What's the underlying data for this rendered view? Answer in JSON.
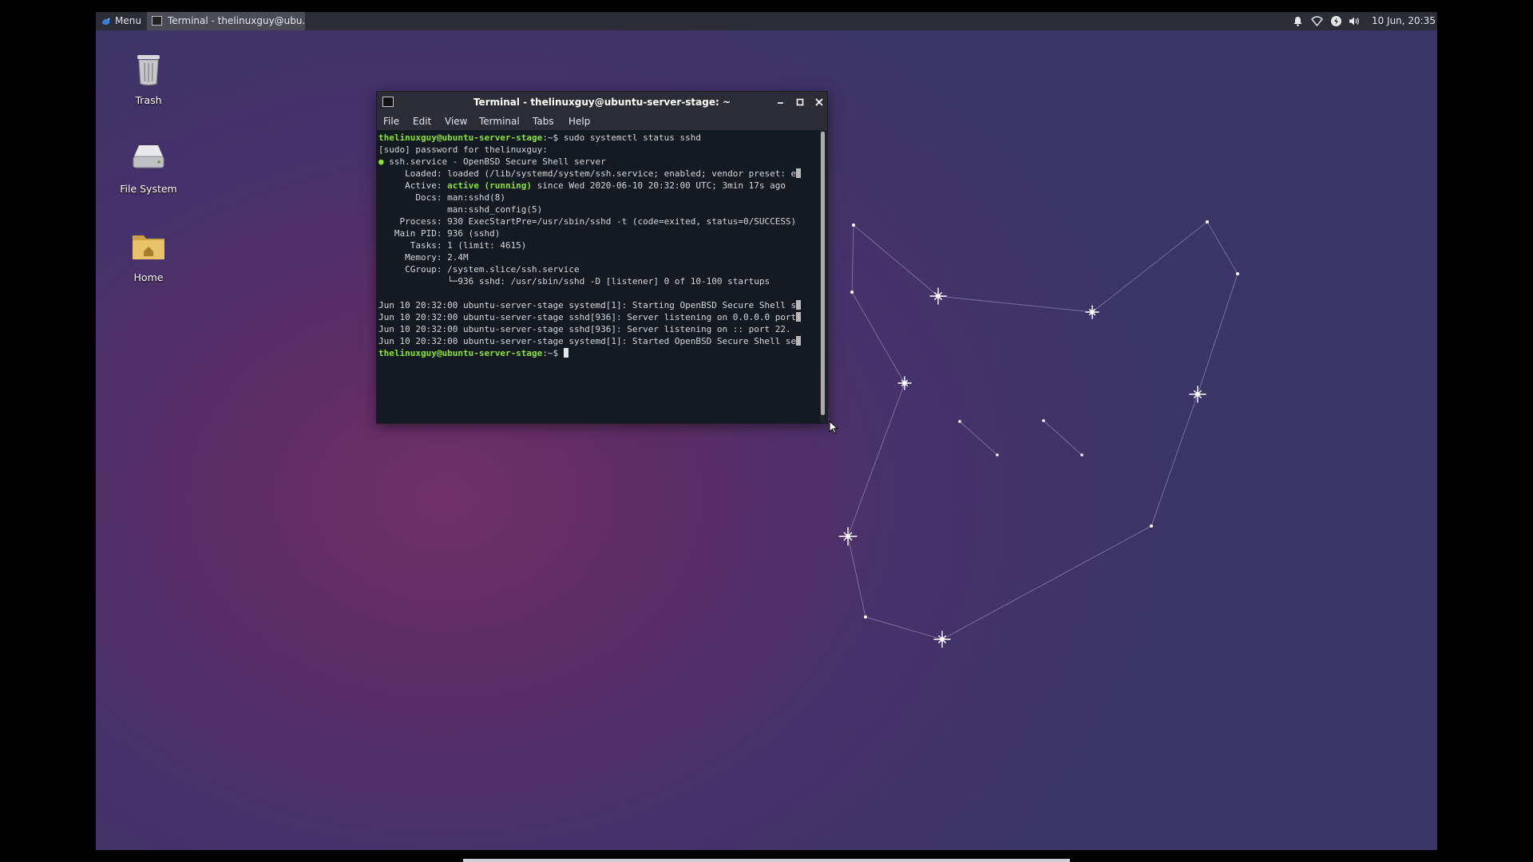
{
  "panel": {
    "menu_label": "Menu",
    "task_label": "Terminal - thelinuxguy@ubu...",
    "clock": "10 Jun, 20:35",
    "tray_icons": [
      "bell-icon",
      "wifi-icon",
      "update-icon",
      "volume-icon"
    ]
  },
  "desktop_icons": {
    "trash": "Trash",
    "filesystem": "File System",
    "home": "Home"
  },
  "terminal": {
    "title": "Terminal - thelinuxguy@ubuntu-server-stage: ~",
    "menu": [
      "File",
      "Edit",
      "View",
      "Terminal",
      "Tabs",
      "Help"
    ],
    "prompt": "thelinuxguy@ubuntu-server-stage",
    "prompt_suffix": ":~$ ",
    "command": "sudo systemctl status sshd",
    "lines": {
      "sudo": "[sudo] password for thelinuxguy:",
      "unit_dot": "●",
      "unit": " ssh.service - OpenBSD Secure Shell server",
      "loaded": "     Loaded: loaded (/lib/systemd/system/ssh.service; enabled; vendor preset: e",
      "active_label": "     Active: ",
      "active_state": "active (running)",
      "active_rest": " since Wed 2020-06-10 20:32:00 UTC; 3min 17s ago",
      "docs1": "       Docs: man:sshd(8)",
      "docs2": "             man:sshd_config(5)",
      "process": "    Process: 930 ExecStartPre=/usr/sbin/sshd -t (code=exited, status=0/SUCCESS)",
      "mainpid": "   Main PID: 936 (sshd)",
      "tasks": "      Tasks: 1 (limit: 4615)",
      "memory": "     Memory: 2.4M",
      "cgroup": "     CGroup: /system.slice/ssh.service",
      "cgroup2": "             └─936 sshd: /usr/sbin/sshd -D [listener] 0 of 10-100 startups",
      "blank": "",
      "log1": "Jun 10 20:32:00 ubuntu-server-stage systemd[1]: Starting OpenBSD Secure Shell s",
      "log2": "Jun 10 20:32:00 ubuntu-server-stage sshd[936]: Server listening on 0.0.0.0 port",
      "log3": "Jun 10 20:32:00 ubuntu-server-stage sshd[936]: Server listening on :: port 22.",
      "log4": "Jun 10 20:32:00 ubuntu-server-stage systemd[1]: Started OpenBSD Secure Shell se"
    }
  },
  "colors": {
    "prompt_green": "#8ae234",
    "terminal_bg": "#141a22",
    "panel_bg": "#2b2c35"
  }
}
